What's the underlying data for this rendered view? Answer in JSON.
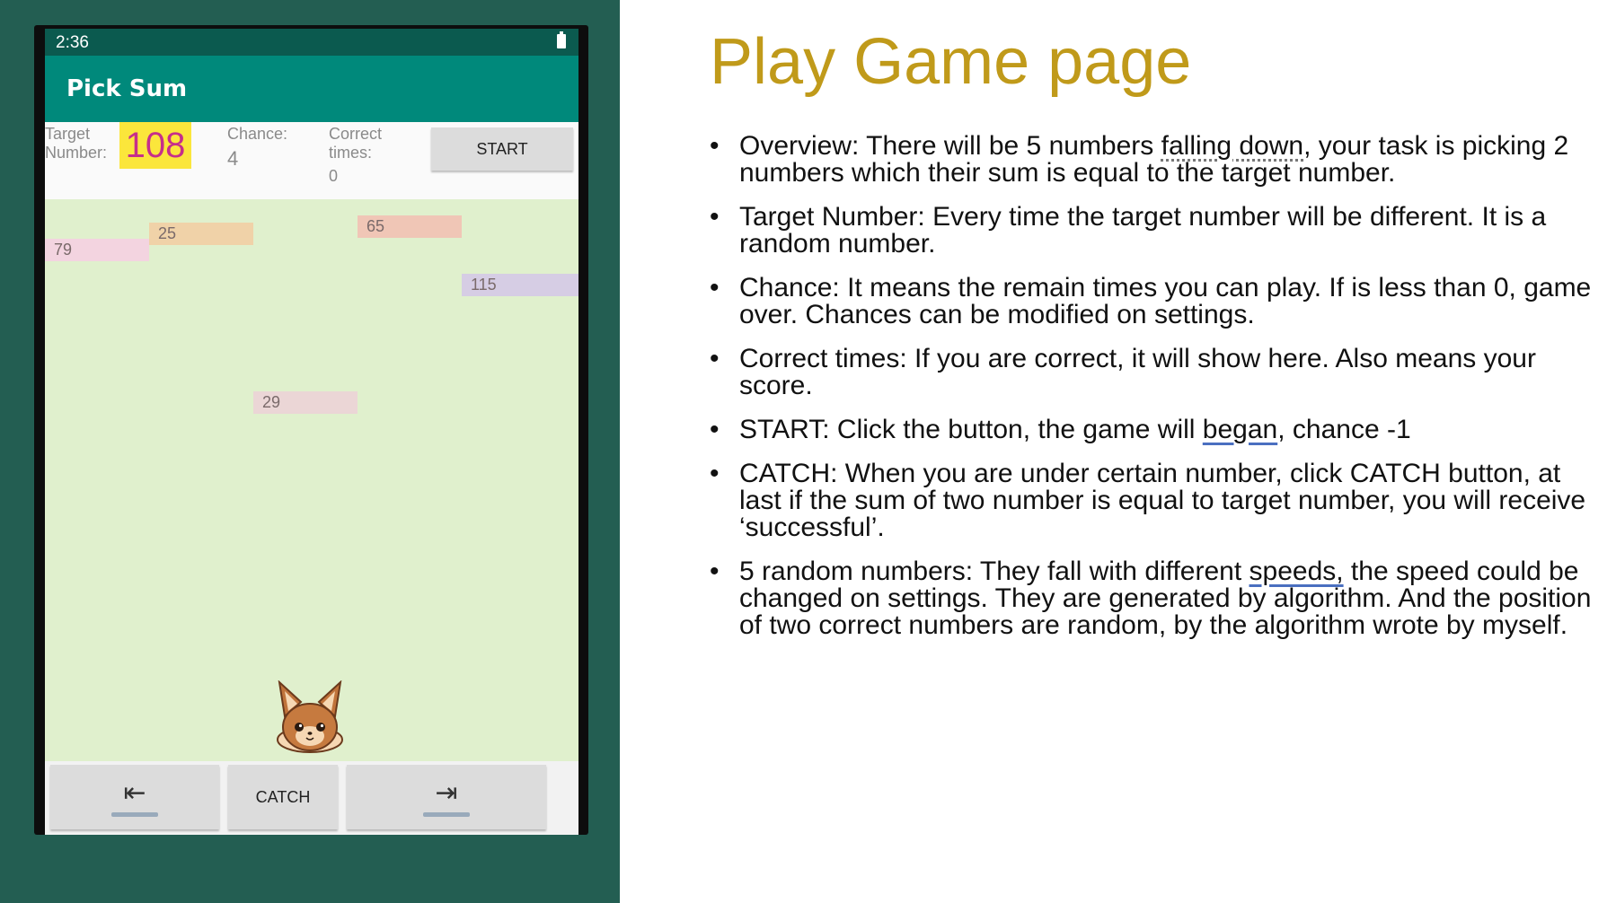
{
  "status_bar": {
    "time": "2:36"
  },
  "app_bar": {
    "title": "Pick Sum"
  },
  "info": {
    "target_label": "Target Number:",
    "target_value": "108",
    "chance_label": "Chance:",
    "chance_value": "4",
    "correct_label": "Correct times:",
    "correct_value": "0",
    "start_label": "START"
  },
  "falling_numbers": [
    {
      "value": "79",
      "color": "#f3d4e0"
    },
    {
      "value": "25",
      "color": "#f0d2a8"
    },
    {
      "value": "65",
      "color": "#f0c6b6"
    },
    {
      "value": "115",
      "color": "#d6cde4"
    },
    {
      "value": "29",
      "color": "#ebd6d6"
    }
  ],
  "controls": {
    "left_icon": "move-left-icon",
    "catch_label": "CATCH",
    "right_icon": "move-right-icon"
  },
  "slide": {
    "title": "Play Game page",
    "bullets": [
      {
        "pre": "Overview: There will be 5 numbers ",
        "ul": "falling down",
        "post": ", your task is picking 2 numbers which their sum is equal to the target number."
      },
      {
        "pre": "Target Number: Every time the target number will be different. It is a random number.",
        "ul": "",
        "post": ""
      },
      {
        "pre": "Chance: It means the remain times you can play. If is less than 0, game over. Chances can be modified on settings.",
        "ul": "",
        "post": ""
      },
      {
        "pre": "Correct times: If you are correct, it will show here. Also means your score.",
        "ul": "",
        "post": ""
      },
      {
        "pre": "START: Click the button, the game will ",
        "ul": "began",
        "post": ", chance -1"
      },
      {
        "pre": "CATCH: When you are under certain number, click CATCH button, at last if the sum of two number is equal to target number, you will receive ‘successful’.",
        "ul": "",
        "post": ""
      },
      {
        "pre": "5 random numbers: They fall with different ",
        "ul": "speeds,",
        "post": " the speed could be changed on settings. They are generated by algorithm. And the position of two correct numbers are random, by the algorithm wrote by myself."
      }
    ]
  },
  "colors": {
    "accent_title": "#c09a1a",
    "app_bar": "#00897b",
    "game_bg": "#e0f0cd",
    "target_highlight": "#fbe63b"
  }
}
